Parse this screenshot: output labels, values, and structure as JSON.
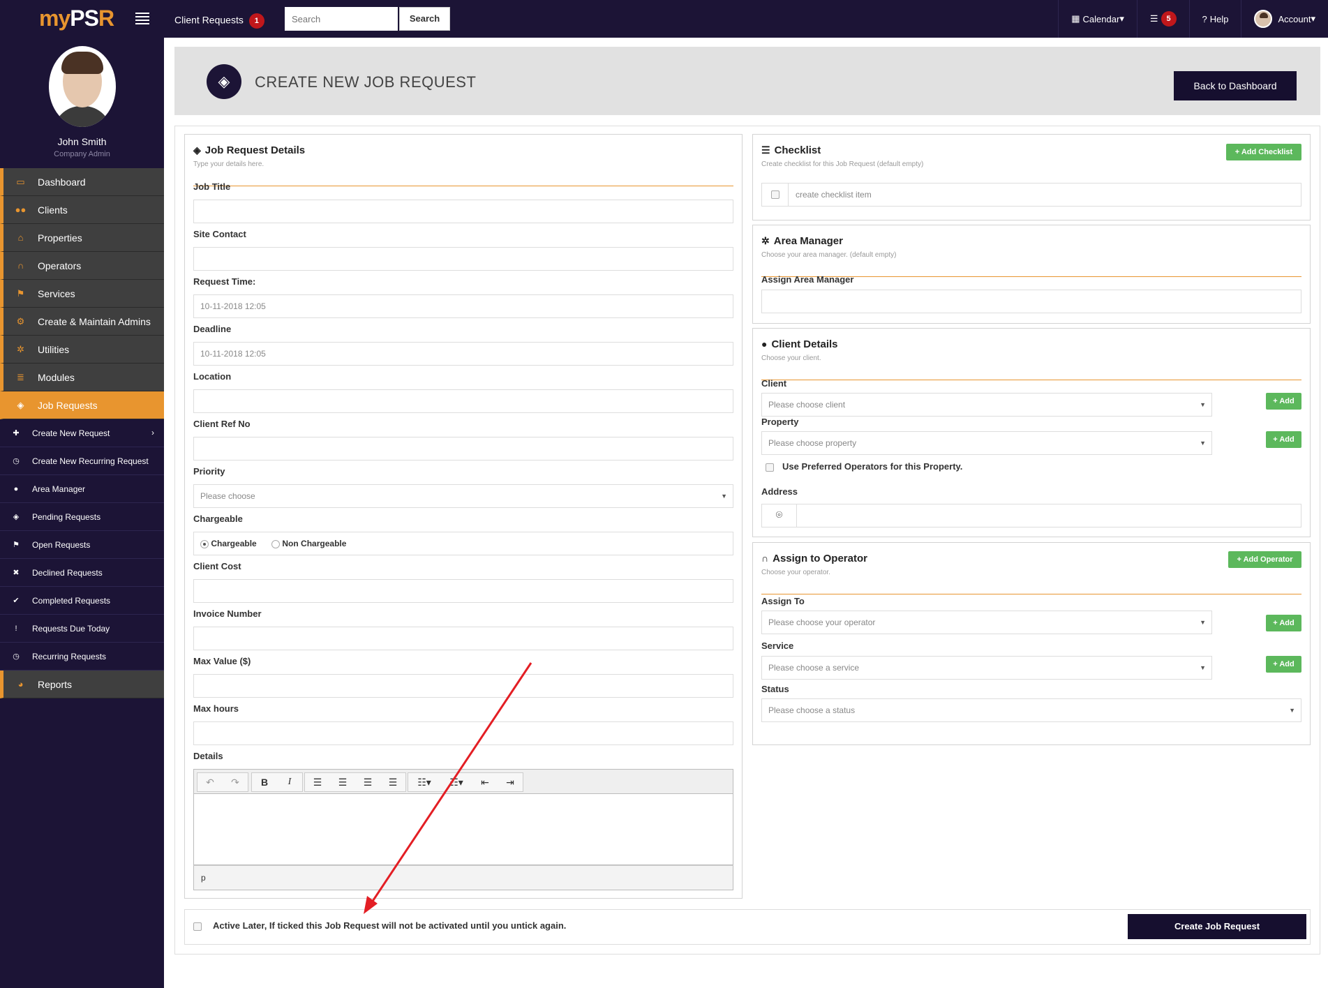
{
  "topbar": {
    "logo_my": "my",
    "logo_ps": "PS",
    "logo_r": "R",
    "client_requests_label": "Client Requests",
    "client_requests_count": "1",
    "search_placeholder": "Search",
    "search_button": "Search",
    "calendar_label": "Calendar",
    "tasks_count": "5",
    "help_label": "Help",
    "account_label": "Account"
  },
  "profile": {
    "name": "John Smith",
    "role": "Company Admin"
  },
  "nav": [
    {
      "label": "Dashboard",
      "icon": "monitor-icon"
    },
    {
      "label": "Clients",
      "icon": "users-icon"
    },
    {
      "label": "Properties",
      "icon": "home-icon"
    },
    {
      "label": "Operators",
      "icon": "headset-icon"
    },
    {
      "label": "Services",
      "icon": "flag-icon"
    },
    {
      "label": "Create & Maintain Admins",
      "icon": "cogs-icon"
    },
    {
      "label": "Utilities",
      "icon": "gear-icon"
    },
    {
      "label": "Modules",
      "icon": "database-icon"
    },
    {
      "label": "Job Requests",
      "icon": "ticket-icon"
    }
  ],
  "subnav": [
    {
      "label": "Create New Request",
      "icon": "plus-icon"
    },
    {
      "label": "Create New Recurring Request",
      "icon": "clock-icon"
    },
    {
      "label": "Area Manager",
      "icon": "users-icon"
    },
    {
      "label": "Pending Requests",
      "icon": "ticket-icon"
    },
    {
      "label": "Open Requests",
      "icon": "flag-icon"
    },
    {
      "label": "Declined Requests",
      "icon": "x-icon"
    },
    {
      "label": "Completed Requests",
      "icon": "check-icon"
    },
    {
      "label": "Requests Due Today",
      "icon": "exclamation-icon"
    },
    {
      "label": "Recurring Requests",
      "icon": "clock-icon"
    }
  ],
  "reports_label": "Reports",
  "header": {
    "title": "CREATE NEW JOB REQUEST",
    "back_button": "Back to Dashboard"
  },
  "job_details": {
    "title": "Job Request Details",
    "subtitle": "Type your details here.",
    "job_title_label": "Job Title",
    "site_contact_label": "Site Contact",
    "request_time_label": "Request Time:",
    "request_time_value": "10-11-2018 12:05",
    "deadline_label": "Deadline",
    "deadline_value": "10-11-2018 12:05",
    "location_label": "Location",
    "client_ref_label": "Client Ref No",
    "priority_label": "Priority",
    "priority_value": "Please choose",
    "chargeable_label": "Chargeable",
    "chargeable_option": "Chargeable",
    "non_chargeable_option": "Non Chargeable",
    "client_cost_label": "Client Cost",
    "invoice_label": "Invoice Number",
    "max_value_label": "Max Value ($)",
    "max_hours_label": "Max hours",
    "details_label": "Details",
    "editor_status": "p"
  },
  "checklist": {
    "title": "Checklist",
    "subtitle": "Create checklist for this Job Request (default empty)",
    "add_button": "+ Add Checklist",
    "item_placeholder": "create checklist item"
  },
  "area_manager": {
    "title": "Area Manager",
    "subtitle": "Choose your area manager. (default empty)",
    "assign_label": "Assign Area Manager"
  },
  "client_details": {
    "title": "Client Details",
    "subtitle": "Choose your client.",
    "client_label": "Client",
    "client_placeholder": "Please choose client",
    "property_label": "Property",
    "property_placeholder": "Please choose property",
    "add_label": "+ Add",
    "preferred_label": "Use Preferred Operators for this Property.",
    "address_label": "Address"
  },
  "operator": {
    "title": "Assign to Operator",
    "subtitle": "Choose your operator.",
    "add_button": "+ Add Operator",
    "assign_label": "Assign To",
    "assign_placeholder": "Please choose your operator",
    "service_label": "Service",
    "service_placeholder": "Please choose a service",
    "status_label": "Status",
    "status_placeholder": "Please choose a status",
    "add_label": "+ Add"
  },
  "footer": {
    "active_later_label": "Active Later, If ticked this Job Request will not be activated until you untick again.",
    "create_button": "Create Job Request"
  },
  "colors": {
    "navy": "#1c1436",
    "orange": "#e8952f",
    "green": "#5cb85c",
    "red_annotation": "#e31e24"
  }
}
